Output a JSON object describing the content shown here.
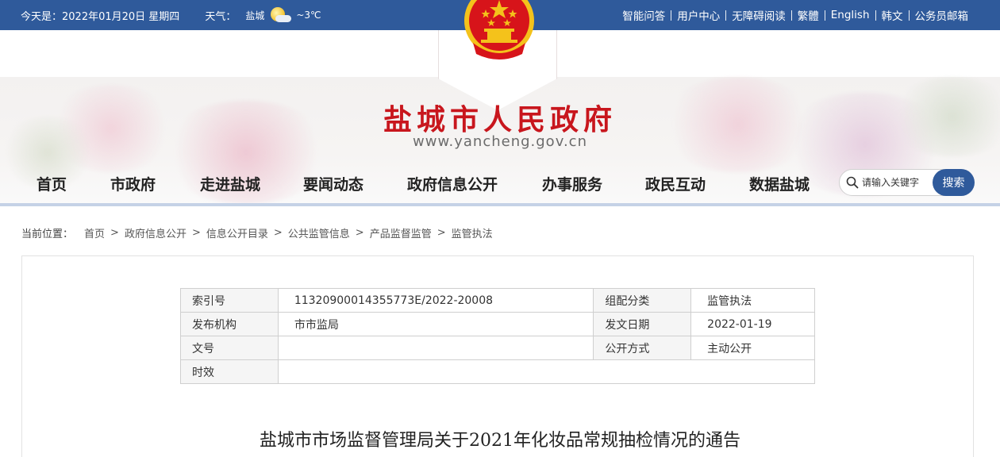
{
  "topbar": {
    "date": "今天是：2022年01月20日 星期四",
    "weather_label": "天气：",
    "weather_city": "盐城",
    "weather_temp": "~3℃",
    "links": [
      "智能问答",
      "用户中心",
      "无障碍阅读",
      "繁體",
      "English",
      "韩文",
      "公务员邮箱"
    ]
  },
  "header": {
    "title": "盐城市人民政府",
    "url": "www.yancheng.gov.cn"
  },
  "nav": {
    "items": [
      "首页",
      "市政府",
      "走进盐城",
      "要闻动态",
      "政府信息公开",
      "办事服务",
      "政民互动",
      "数据盐城"
    ]
  },
  "search": {
    "placeholder": "请输入关键字",
    "button": "搜索"
  },
  "breadcrumb": {
    "label": "当前位置：",
    "items": [
      "首页",
      "政府信息公开",
      "信息公开目录",
      "公共监管信息",
      "产品监督监管",
      "监管执法"
    ]
  },
  "meta": {
    "rows": [
      {
        "k1": "索引号",
        "v1": "11320900014355773E/2022-20008",
        "k2": "组配分类",
        "v2": "监管执法"
      },
      {
        "k1": "发布机构",
        "v1": "市市监局",
        "k2": "发文日期",
        "v2": "2022-01-19"
      },
      {
        "k1": "文号",
        "v1": "",
        "k2": "公开方式",
        "v2": "主动公开"
      },
      {
        "k1": "时效",
        "v1": ""
      }
    ]
  },
  "article": {
    "title": "盐城市市场监督管理局关于2021年化妆品常规抽检情况的通告"
  },
  "colors": {
    "topbar": "#2f5a9b",
    "title_red": "#c8161d",
    "emblem_red": "#d7141a",
    "emblem_gold": "#f4c21b"
  }
}
